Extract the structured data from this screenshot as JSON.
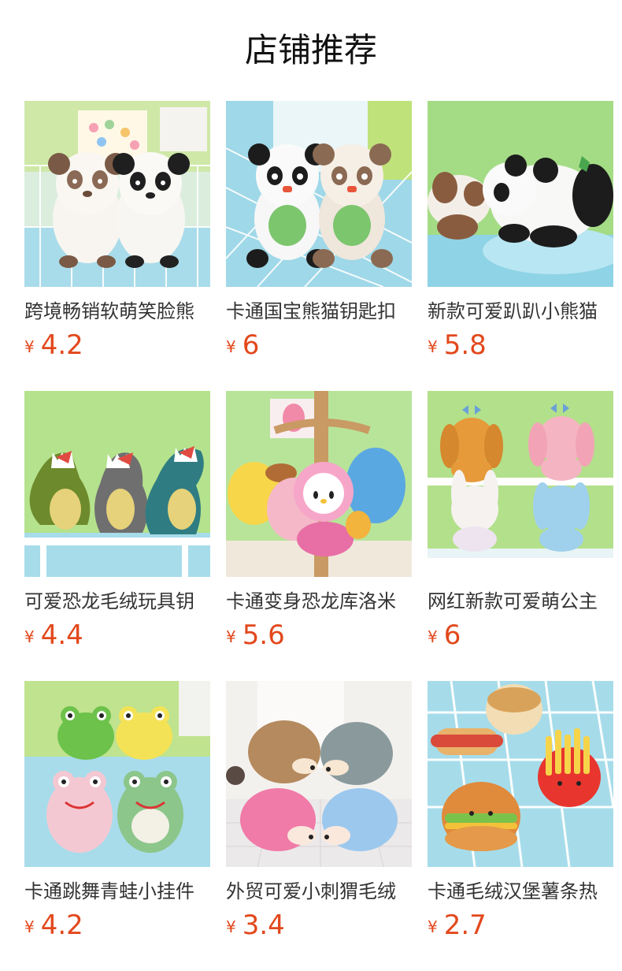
{
  "header": {
    "title": "店铺推荐"
  },
  "currency_symbol": "¥",
  "colors": {
    "price": "#e2481c",
    "title": "#111111"
  },
  "products": [
    {
      "name": "跨境畅销软萌笑脸熊",
      "price": "4.2",
      "image_icon": "panda-plush-pair-image"
    },
    {
      "name": "卡通国宝熊猫钥匙扣",
      "price": "6",
      "image_icon": "panda-keychain-image"
    },
    {
      "name": "新款可爱趴趴小熊猫",
      "price": "5.8",
      "image_icon": "lying-panda-image"
    },
    {
      "name": "可爱恐龙毛绒玩具钥",
      "price": "4.4",
      "image_icon": "dinosaur-plush-image"
    },
    {
      "name": "卡通变身恐龙库洛米",
      "price": "5.6",
      "image_icon": "hanging-plush-image"
    },
    {
      "name": "网红新款可爱萌公主",
      "price": "6",
      "image_icon": "bunny-puppy-plush-image"
    },
    {
      "name": "卡通跳舞青蛙小挂件",
      "price": "4.2",
      "image_icon": "frog-plush-image"
    },
    {
      "name": "外贸可爱小刺猬毛绒",
      "price": "3.4",
      "image_icon": "hedgehog-plush-image"
    },
    {
      "name": "卡通毛绒汉堡薯条热",
      "price": "2.7",
      "image_icon": "burger-fries-plush-image"
    }
  ]
}
